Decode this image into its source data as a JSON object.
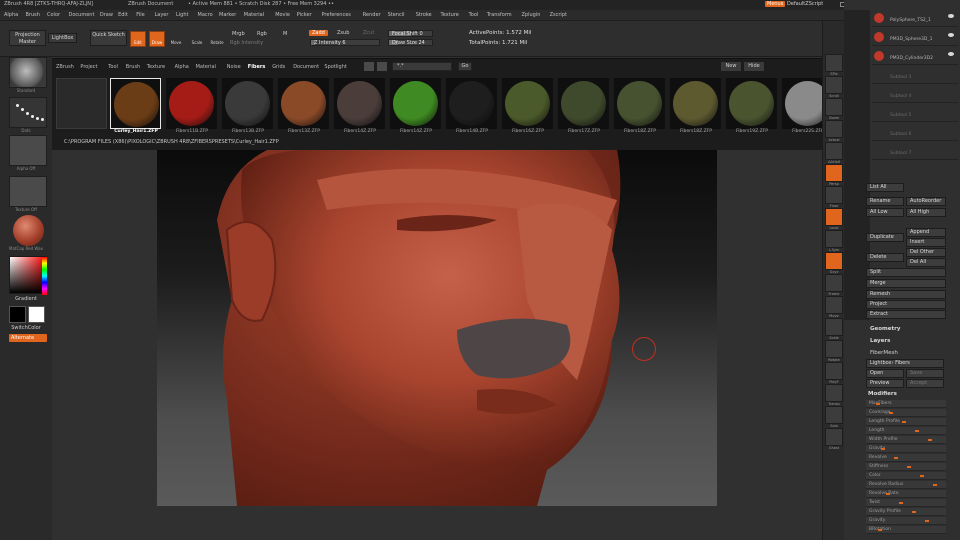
{
  "titlebar": {
    "app": "ZBrush 4R8 [ZTKS-THRQ-AFAJ-ZLJN]",
    "doc": "ZBrush Document",
    "mem": "• Active Mem 881  • Scratch Disk 287  • Free Mem 3294  ••",
    "menus_btn": "Menus",
    "script": "DefaultZScript"
  },
  "menubar": [
    "Alpha",
    "Brush",
    "Color",
    "Document",
    "Draw",
    "Edit",
    "File",
    "Layer",
    "Light",
    "Macro",
    "Marker",
    "Material",
    "Movie",
    "Picker",
    "Preferences",
    "Render",
    "Stencil",
    "Stroke",
    "Texture",
    "Tool",
    "Transform",
    "Zplugin",
    "Zscript"
  ],
  "shelf": {
    "projection_master": "Projection Master",
    "lightbox": "LightBox",
    "quick_sketch": "Quick Sketch",
    "edit": "Edit",
    "draw": "Draw",
    "move": "Move",
    "scale": "Scale",
    "rotate": "Rotate",
    "mrgb": "Mrgb",
    "rgb": "Rgb",
    "m": "M",
    "rgb_intensity": "Rgb Intensity",
    "zadd": "Zadd",
    "zsub": "Zsub",
    "zcut": "Zcut",
    "z_intensity": "Z Intensity 6",
    "focal_shift": "Focal Shift 0",
    "draw_size": "Draw Size 24",
    "active_points": "ActivePoints: 1.572 Mil",
    "total_points": "TotalPoints: 1.721 Mil",
    "z_intensity_level": 0.06,
    "focal_shift_level": 0.5,
    "draw_size_level": 0.2
  },
  "left": {
    "brush_cap": "Standard",
    "stroke_cap": "Dots",
    "alpha_cap": "Alpha Off",
    "texture_cap": "Texture Off",
    "material_cap": "MatCap Red Wax",
    "gradient": "Gradient",
    "switch_color": "SwitchColor",
    "alternate": "Alternate"
  },
  "lightbox": {
    "tabs": [
      "ZBrush",
      "Project",
      "Tool",
      "Brush",
      "Texture",
      "Alpha",
      "Material",
      "Noise",
      "Fibers",
      "Grids",
      "Document",
      "Spotlight"
    ],
    "active_tab": "Fibers",
    "search_value": "*.*",
    "go": "Go",
    "new": "New",
    "hide": "Hide",
    "items": [
      {
        "label": "Curley_Hair1.ZFP",
        "color": "#6b3d16"
      },
      {
        "label": "Fibers11B.ZFP",
        "color": "#a51c17"
      },
      {
        "label": "Fibers13B.ZFP",
        "color": "#3a3a3a"
      },
      {
        "label": "Fibers13Z.ZFP",
        "color": "#8a4a28"
      },
      {
        "label": "Fibers14Z.ZFP",
        "color": "#4a3d3a"
      },
      {
        "label": "Fibers14Z.ZFP",
        "color": "#3f8a22"
      },
      {
        "label": "Fibers14B.ZFP",
        "color": "#1e1e1e"
      },
      {
        "label": "Fibers16Z.ZFP",
        "color": "#4b5a2a"
      },
      {
        "label": "Fibers17Z.ZFP",
        "color": "#3f4a2c"
      },
      {
        "label": "Fibers18Z.ZFP",
        "color": "#465230"
      },
      {
        "label": "Fibers18Z.ZFP",
        "color": "#5d5a30"
      },
      {
        "label": "Fibers19Z.ZFP",
        "color": "#4a5530"
      },
      {
        "label": "Fibers22S.ZFP",
        "color": "#8a8a8a"
      }
    ],
    "path": "C:\\PROGRAM FILES (X86)\\PIXOLOGIC\\ZBRUSH 4R8\\ZFIBERSPRESETS\\Curley_Hair1.ZFP"
  },
  "rshelf": [
    "SPix",
    "Scroll",
    "Zoom",
    "Actual",
    "AAHalf",
    "Persp",
    "Floor",
    "Local",
    "L.Sym",
    "Gxyz",
    "Frame",
    "Move",
    "Scale",
    "Rotate",
    "PolyF",
    "Transp",
    "Solo",
    "Ghost"
  ],
  "rpanel": {
    "subtools": [
      "PolySphere_TS2_1",
      "PM3D_Sphere3D_1",
      "PM3D_Cylinder3D2",
      "Subtool 3",
      "Subtool 4",
      "Subtool 5",
      "Subtool 6",
      "Subtool 7"
    ],
    "list_all": "List All",
    "rename": "Rename",
    "auto_reorder": "AutoReorder",
    "all_low": "All Low",
    "all_high": "All High",
    "duplicate": "Duplicate",
    "append": "Append",
    "insert": "Insert",
    "delete": "Delete",
    "del_other": "Del Other",
    "del_all": "Del All",
    "split": "Split",
    "merge": "Merge",
    "remesh": "Remesh",
    "project": "Project",
    "extract": "Extract",
    "geometry": "Geometry",
    "layers": "Layers",
    "fibermesh": "FiberMesh",
    "lightbox_fibers": "Lightbox› Fibers",
    "open": "Open",
    "save": "Save",
    "preview": "Preview",
    "accept": "Accept",
    "modifiers": "Modifiers",
    "modifier_rows": [
      "MaxFibers",
      "Coverage",
      "Length Profile",
      "Length",
      "Width Profile",
      "Gravity",
      "Revolve",
      "Stiffness",
      "Color",
      "Revolve Radius",
      "Revolve Rate",
      "Twist",
      "Gravity Profile",
      "Gravity",
      "BRotation"
    ]
  }
}
